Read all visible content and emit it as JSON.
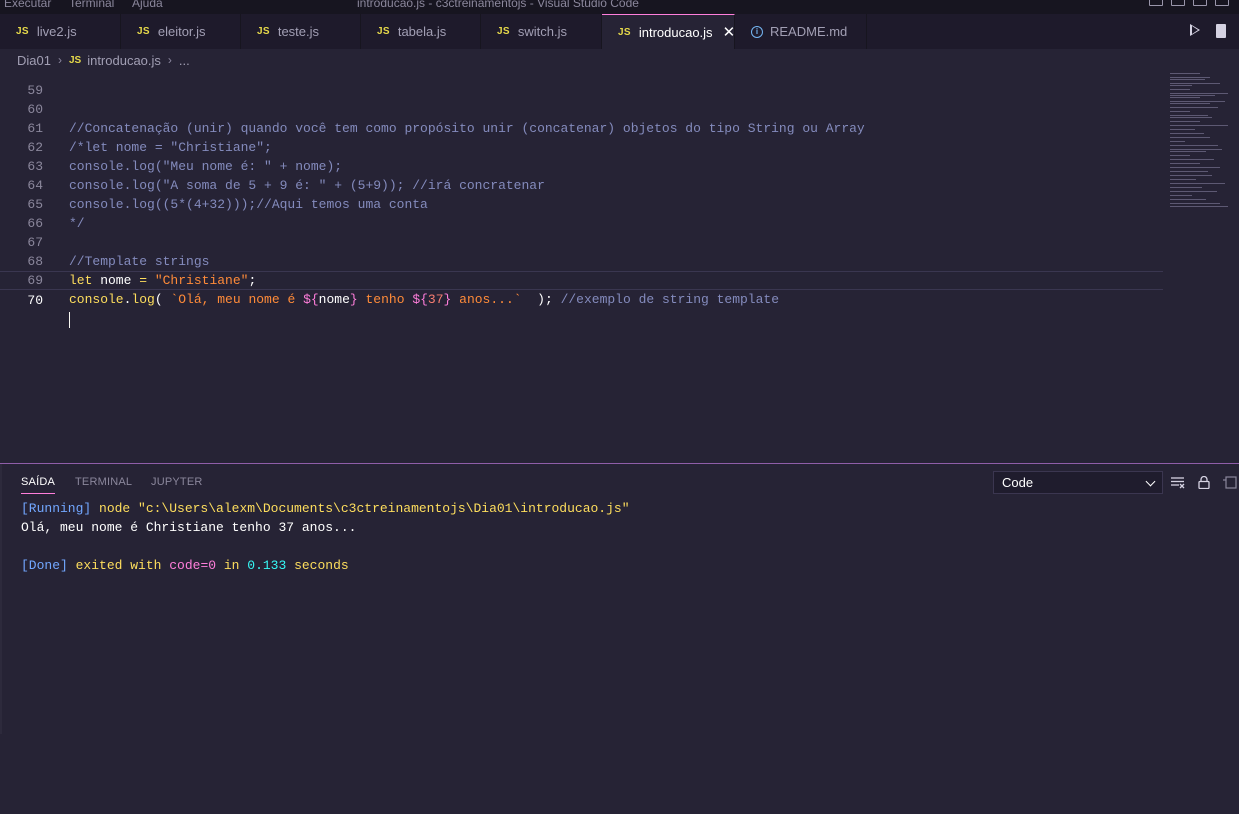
{
  "titlebar": {
    "menu": [
      "Executar",
      "Terminal",
      "Ajuda"
    ],
    "title": "introducao.js - c3ctreinamentojs - Visual Studio Code"
  },
  "tabs": [
    {
      "name": "live2.js",
      "type": "js",
      "active": false
    },
    {
      "name": "eleitor.js",
      "type": "js",
      "active": false
    },
    {
      "name": "teste.js",
      "type": "js",
      "active": false
    },
    {
      "name": "tabela.js",
      "type": "js",
      "active": false
    },
    {
      "name": "switch.js",
      "type": "js",
      "active": false
    },
    {
      "name": "introducao.js",
      "type": "js",
      "active": true
    },
    {
      "name": "README.md",
      "type": "md",
      "active": false
    }
  ],
  "tab_badge_js": "JS",
  "breadcrumbs": {
    "folder": "Dia01",
    "file": "introducao.js",
    "more": "..."
  },
  "editor": {
    "lines": [
      {
        "num": "59"
      },
      {
        "num": "60"
      },
      {
        "num": "61"
      },
      {
        "num": "62"
      },
      {
        "num": "63"
      },
      {
        "num": "64"
      },
      {
        "num": "65"
      },
      {
        "num": "66"
      },
      {
        "num": "67"
      },
      {
        "num": "68"
      },
      {
        "num": "69"
      },
      {
        "num": "70"
      }
    ],
    "code": {
      "l60": "//Concatenação (unir) quando você tem como propósito unir (concatenar) objetos do tipo String ou Array",
      "l61": "/*let nome = \"Christiane\";",
      "l62": "console.log(\"Meu nome é: \" + nome);",
      "l63": "console.log(\"A soma de 5 + 9 é: \" + (5+9)); //irá concratenar",
      "l64": "console.log((5*(4+32)));//Aqui temos uma conta",
      "l65": "*/",
      "l67": "//Template strings",
      "l68_let": "let",
      "l68_name": " nome ",
      "l68_eq": "=",
      "l68_str": " \"Christiane\"",
      "l68_semi": ";",
      "l69_console": "console",
      "l69_dot": ".",
      "l69_log": "log",
      "l69_open": "( ",
      "l69_tpl1": "`Olá, meu nome é ",
      "l69_d1": "${",
      "l69_v1": "nome",
      "l69_d1e": "}",
      "l69_tpl2": " tenho ",
      "l69_d2": "${",
      "l69_v2": "37",
      "l69_d2e": "}",
      "l69_tpl3": " anos...`",
      "l69_close": "  ); ",
      "l69_cmt": "//exemplo de string template"
    },
    "current_line": "70"
  },
  "panel": {
    "tabs": [
      "SAÍDA",
      "TERMINAL",
      "JUPYTER"
    ],
    "active_tab": "SAÍDA",
    "output_channel": "Code",
    "output": {
      "running_tag": "[Running]",
      "running_cmd": " node \"c:\\Users\\alexm\\Documents\\c3ctreinamentojs\\Dia01\\introducao.js\"",
      "result": "Olá, meu nome é Christiane tenho 37 anos...",
      "done_tag": "[Done]",
      "done_text1": " exited with ",
      "done_code": "code=0",
      "done_text2": " in ",
      "done_time": "0.133",
      "done_text3": " seconds"
    }
  },
  "colors": {
    "background": "#262335",
    "tabbar": "#1e1a2b",
    "accent": "#ff7edb",
    "keyword": "#fede5d",
    "string": "#ff8b39",
    "comment": "#848bbd"
  }
}
